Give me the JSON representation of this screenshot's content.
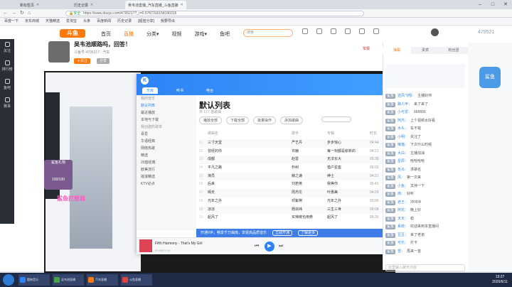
{
  "browser": {
    "tabs": [
      "新标签页",
      "历史记录",
      "吴韦池直播_汽车直播_斗鱼直播"
    ],
    "address": "https://www.douyu.com/4795217?_r=0.5767316158190315",
    "secure_label": "安全",
    "bookmarks": [
      "百度一下",
      "京东商城",
      "天猫精选",
      "爱淘宝",
      "头条",
      "百度新闻",
      "历史记录",
      "[超值分享]",
      "我要导出"
    ],
    "controls": [
      "–",
      "□",
      "✕"
    ]
  },
  "site": {
    "logo": "斗鱼",
    "nav": [
      "首页",
      "直播",
      "分类▾",
      "视频",
      "游戏▾",
      "鱼吧"
    ],
    "active_nav": "直播",
    "search_placeholder": "搜索",
    "room_count": "479521",
    "left_sidebar": [
      "关注",
      "排行榜",
      "鱼吧",
      "赛事"
    ]
  },
  "streamer": {
    "title": "吴韦池顺路吗，回答！",
    "subtitle": "斗鱼号 4795217 · 汽车",
    "follow_label": "＋关注",
    "share_label": "分享",
    "report_label": "举报"
  },
  "stream_overlay": {
    "gift_label": "鲨鱼礼物",
    "progress": "100/100",
    "banner": "鲨鱼拦截器"
  },
  "kugou": {
    "logo": "K",
    "tabs": [
      "乐库",
      "听书",
      "电台"
    ],
    "active_tab": "乐库",
    "sidebar_groups": [
      {
        "heading": "我的音乐",
        "items": [
          "默认列表",
          "最近播放",
          "本地与下载"
        ]
      },
      {
        "heading": "我创建的歌单",
        "items": [
          "喜爱",
          "华语经典",
          "网络热歌",
          "精选",
          "20首经典",
          "欧美流行",
          "摇滚精选",
          "KTV必点"
        ]
      }
    ],
    "selected_item": "默认列表",
    "list_title": "默认列表",
    "song_count": "共 177 首歌曲",
    "tools": [
      "播放全部",
      "下载全部",
      "批量操作",
      "添加歌曲"
    ],
    "columns": [
      "歌曲名",
      "歌手",
      "专辑",
      "时长"
    ],
    "songs": [
      {
        "n": "01",
        "title": "三寸天堂",
        "artist": "严艺丹",
        "album": "步步惊心",
        "time": "04:44"
      },
      {
        "n": "02",
        "title": "曾经的你",
        "artist": "许巍",
        "album": "每一刻都是崭新的",
        "time": "04:21"
      },
      {
        "n": "03",
        "title": "成都",
        "artist": "赵雷",
        "album": "无法长大",
        "time": "05:28"
      },
      {
        "n": "04",
        "title": "平凡之路",
        "artist": "朴树",
        "album": "猎户星座",
        "time": "05:02"
      },
      {
        "n": "05",
        "title": "演员",
        "artist": "薛之谦",
        "album": "绅士",
        "time": "04:21"
      },
      {
        "n": "06",
        "title": "后来",
        "artist": "刘若英",
        "album": "我等你",
        "time": "05:41"
      },
      {
        "n": "07",
        "title": "晴天",
        "artist": "周杰伦",
        "album": "叶惠美",
        "time": "04:29"
      },
      {
        "n": "08",
        "title": "光年之外",
        "artist": "邓紫棋",
        "album": "光年之外",
        "time": "03:55"
      },
      {
        "n": "09",
        "title": "凉凉",
        "artist": "杨宗纬",
        "album": "三生三世",
        "time": "05:08"
      },
      {
        "n": "10",
        "title": "起风了",
        "artist": "买辣椒也用券",
        "album": "起风了",
        "time": "05:25"
      }
    ],
    "notice": "开通VIP，畅享千万曲库，享受高品质音乐",
    "notice_buttons": [
      "立即开通",
      "了解更多"
    ],
    "now_playing": "Fifth Harmony - That's My Girl",
    "time": "00:58/03:24"
  },
  "chat": {
    "tabs": [
      "弹幕",
      "贵宾",
      "粉丝团"
    ],
    "active_tab": "弹幕",
    "messages": [
      {
        "badge": "鲨鱼",
        "user": "逆风飞翔：",
        "text": "主播好帅"
      },
      {
        "badge": "鲨鱼",
        "user": "路人甲：",
        "text": "来了来了"
      },
      {
        "badge": "鲨鱼",
        "user": "小可爱：",
        "text": "666666"
      },
      {
        "badge": "鲨鱼",
        "user": "阿杰：",
        "text": "上个视频太好看"
      },
      {
        "badge": "鲨鱼",
        "user": "木头：",
        "text": "车不错"
      },
      {
        "badge": "鲨鱼",
        "user": "小明：",
        "text": "关注了"
      },
      {
        "badge": "鲨鱼",
        "user": "懒猫：",
        "text": "下次什么时候"
      },
      {
        "badge": "鲨鱼",
        "user": "大白：",
        "text": "主播加油"
      },
      {
        "badge": "鲨鱼",
        "user": "星辰：",
        "text": "哈哈哈哈"
      },
      {
        "badge": "鲨鱼",
        "user": "冬瓜：",
        "text": "求歌名"
      },
      {
        "badge": "鲨鱼",
        "user": "风：",
        "text": "第一次来"
      },
      {
        "badge": "鲨鱼",
        "user": "小鱼：",
        "text": "支持一下"
      },
      {
        "badge": "鲨鱼",
        "user": "雨：",
        "text": "好听"
      },
      {
        "badge": "鲨鱼",
        "user": "老王：",
        "text": "冲冲冲"
      },
      {
        "badge": "鲨鱼",
        "user": "阿花：",
        "text": "晚上好"
      },
      {
        "badge": "鲨鱼",
        "user": "天天：",
        "text": "稳"
      },
      {
        "badge": "鲨鱼",
        "user": "系统：",
        "text": "欢迎来到本直播间"
      },
      {
        "badge": "鲨鱼",
        "user": "豆豆：",
        "text": "来了老弟"
      },
      {
        "badge": "鲨鱼",
        "user": "可乐：",
        "text": "打卡"
      },
      {
        "badge": "鲨鱼",
        "user": "雪：",
        "text": "再来一首"
      }
    ],
    "input_placeholder": "这里输入聊天内容",
    "mascot": "鲨鱼"
  },
  "taskbar": {
    "apps": [
      "酷狗音乐",
      "吴韦池直播",
      "汽车直播",
      "斗鱼直播"
    ],
    "clock_time": "15:27",
    "clock_date": "2020/6/11"
  }
}
